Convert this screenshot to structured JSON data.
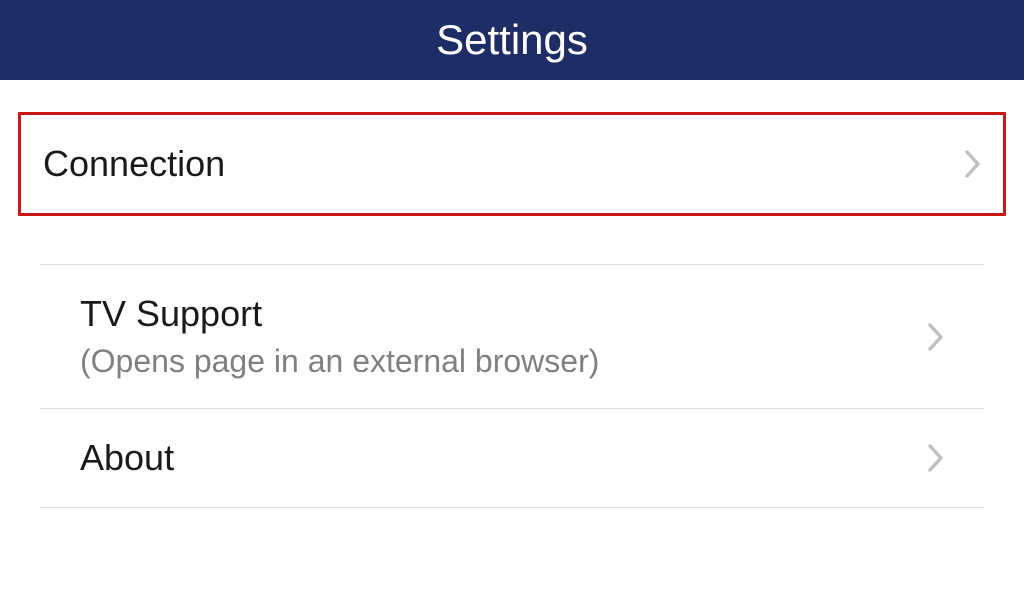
{
  "header": {
    "title": "Settings"
  },
  "items": [
    {
      "label": "Connection",
      "highlighted": true
    },
    {
      "label": "TV Support",
      "subtitle": "(Opens page in an external browser)"
    },
    {
      "label": "About"
    }
  ]
}
